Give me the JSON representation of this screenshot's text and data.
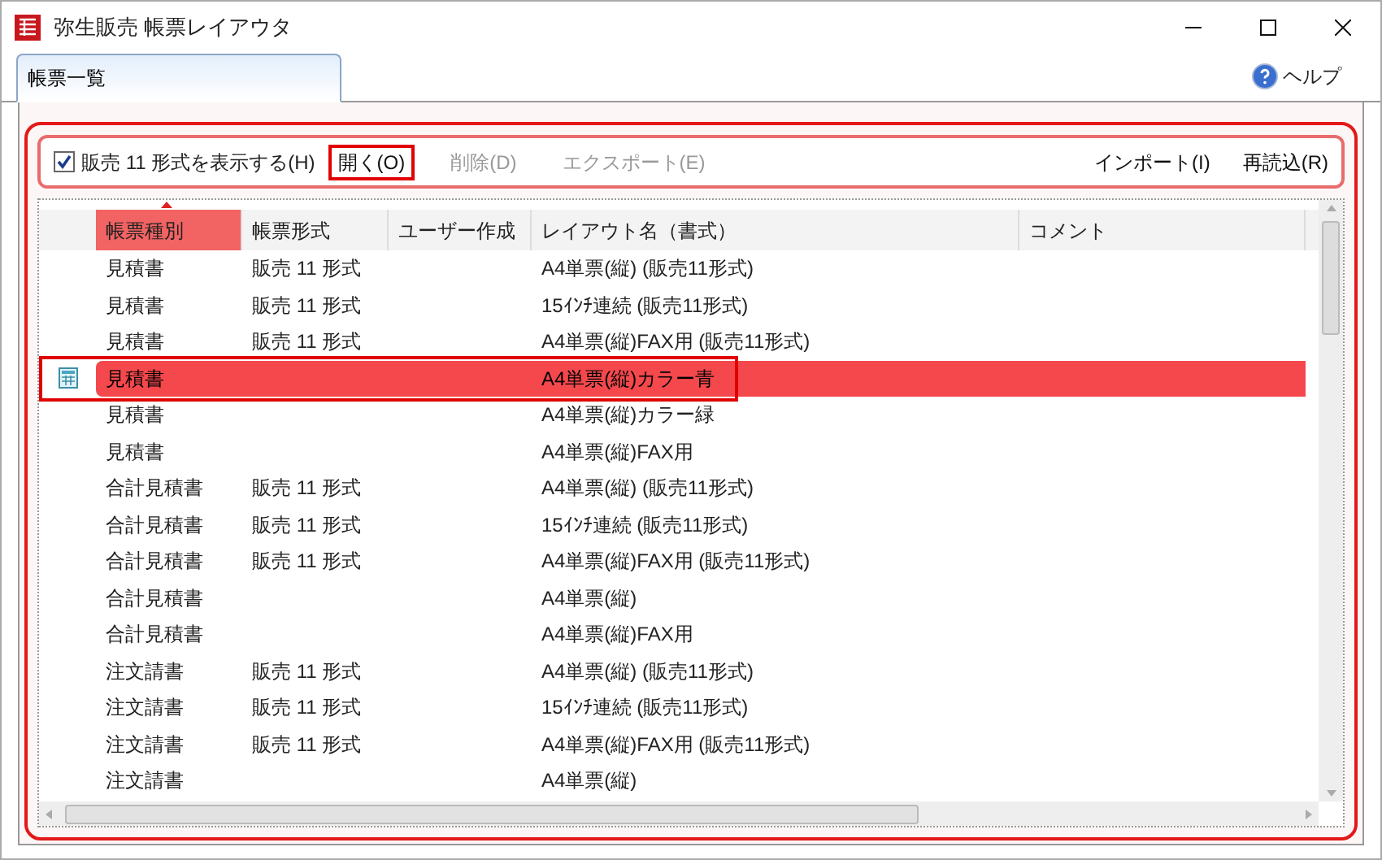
{
  "window": {
    "title": "弥生販売 帳票レイアウタ"
  },
  "tabs": [
    {
      "label": "帳票一覧",
      "selected": true
    }
  ],
  "help": {
    "label": "ヘルプ"
  },
  "toolbar": {
    "checkbox": {
      "label": "販売 11 形式を表示する(H)",
      "checked": true
    },
    "buttons": [
      {
        "label": "開く(O)",
        "disabled": false,
        "highlighted": true
      },
      {
        "label": "削除(D)",
        "disabled": true,
        "highlighted": false
      },
      {
        "label": "エクスポート(E)",
        "disabled": true,
        "highlighted": false
      }
    ],
    "right_buttons": [
      {
        "label": "インポート(I)",
        "disabled": false
      },
      {
        "label": "再読込(R)",
        "disabled": false
      }
    ]
  },
  "table": {
    "columns": [
      {
        "label": "帳票種別",
        "sorted": true
      },
      {
        "label": "帳票形式",
        "sorted": false
      },
      {
        "label": "ユーザー作成",
        "sorted": false
      },
      {
        "label": "レイアウト名（書式）",
        "sorted": false
      },
      {
        "label": "コメント",
        "sorted": false
      }
    ],
    "rows": [
      {
        "type": "見積書",
        "format": "販売 11 形式",
        "layout": "A4単票(縦) (販売11形式)",
        "selected": false
      },
      {
        "type": "見積書",
        "format": "販売 11 形式",
        "layout": "15ｲﾝﾁ連続 (販売11形式)",
        "selected": false
      },
      {
        "type": "見積書",
        "format": "販売 11 形式",
        "layout": "A4単票(縦)FAX用 (販売11形式)",
        "selected": false
      },
      {
        "type": "見積書",
        "layout": "A4単票(縦)カラー青",
        "selected": true
      },
      {
        "type": "見積書",
        "layout": "A4単票(縦)カラー緑",
        "selected": false
      },
      {
        "type": "見積書",
        "layout": "A4単票(縦)FAX用",
        "selected": false
      },
      {
        "type": "合計見積書",
        "format": "販売 11 形式",
        "layout": "A4単票(縦) (販売11形式)",
        "selected": false
      },
      {
        "type": "合計見積書",
        "format": "販売 11 形式",
        "layout": "15ｲﾝﾁ連続 (販売11形式)",
        "selected": false
      },
      {
        "type": "合計見積書",
        "format": "販売 11 形式",
        "layout": "A4単票(縦)FAX用 (販売11形式)",
        "selected": false
      },
      {
        "type": "合計見積書",
        "layout": "A4単票(縦)",
        "selected": false
      },
      {
        "type": "合計見積書",
        "layout": "A4単票(縦)FAX用",
        "selected": false
      },
      {
        "type": "注文請書",
        "format": "販売 11 形式",
        "layout": "A4単票(縦) (販売11形式)",
        "selected": false
      },
      {
        "type": "注文請書",
        "format": "販売 11 形式",
        "layout": "15ｲﾝﾁ連続 (販売11形式)",
        "selected": false
      },
      {
        "type": "注文請書",
        "format": "販売 11 形式",
        "layout": "A4単票(縦)FAX用 (販売11形式)",
        "selected": false
      },
      {
        "type": "注文請書",
        "layout": "A4単票(縦)",
        "selected": false
      }
    ]
  }
}
